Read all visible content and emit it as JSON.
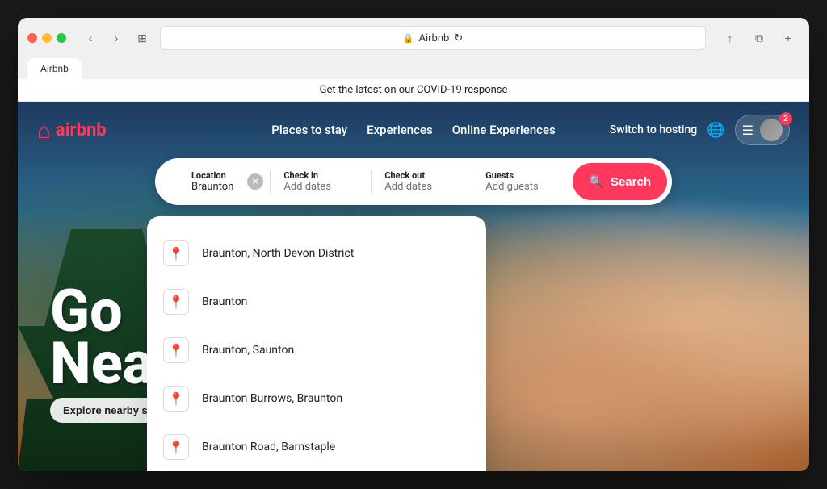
{
  "browser": {
    "tab_title": "Airbnb",
    "address": "Airbnb",
    "back_label": "‹",
    "forward_label": "›",
    "reader_label": "⊞",
    "reload_label": "↻",
    "share_label": "↑",
    "tabs_label": "⧉",
    "new_tab_label": "+"
  },
  "covid_banner": {
    "text": "Get the latest on our COVID-19 response"
  },
  "nav": {
    "logo_text": "airbnb",
    "logo_icon": "⌂",
    "links": [
      {
        "label": "Places to stay",
        "key": "places"
      },
      {
        "label": "Experiences",
        "key": "experiences"
      },
      {
        "label": "Online Experiences",
        "key": "online"
      }
    ],
    "switch_hosting": "Switch to hosting",
    "notification_count": "2"
  },
  "search": {
    "location_label": "Location",
    "location_value": "Braunton",
    "checkin_label": "Check in",
    "checkin_placeholder": "Add dates",
    "checkout_label": "Check out",
    "checkout_placeholder": "Add dates",
    "guests_label": "Guests",
    "guests_placeholder": "Add guests",
    "button_label": "Search",
    "search_icon": "🔍"
  },
  "dropdown": {
    "items": [
      {
        "label": "Braunton, North Devon District",
        "icon": "📍"
      },
      {
        "label": "Braunton",
        "icon": "📍"
      },
      {
        "label": "Braunton, Saunton",
        "icon": "📍"
      },
      {
        "label": "Braunton Burrows, Braunton",
        "icon": "📍"
      },
      {
        "label": "Braunton Road, Barnstaple",
        "icon": "📍"
      }
    ]
  },
  "hero": {
    "title_line1": "Go",
    "title_line2": "Nea",
    "explore_label": "Explore nearby stays"
  }
}
